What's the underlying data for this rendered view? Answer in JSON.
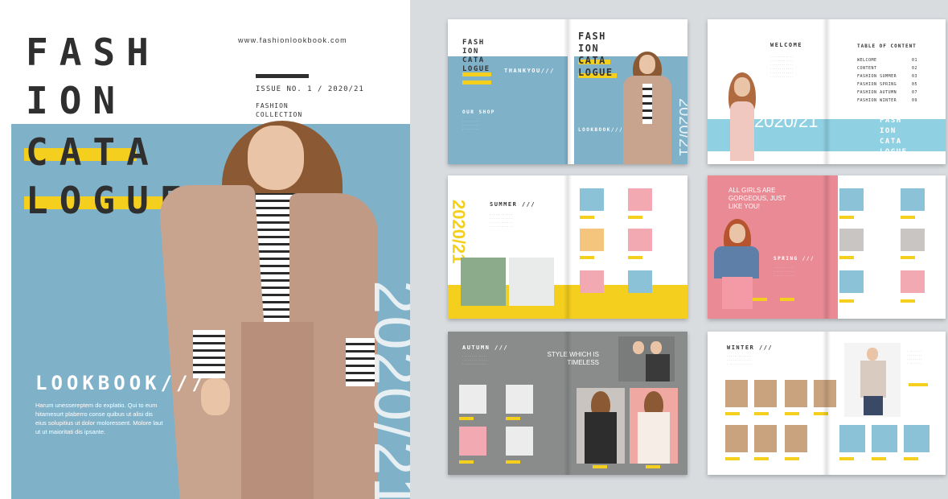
{
  "cover": {
    "title_lines": [
      "FASH",
      "ION",
      "CATA",
      "LOGUE"
    ],
    "website": "www.fashionlookbook.com",
    "issue": "ISSUE NO. 1 / 2020/21",
    "collection": "FASHION\nCOLLECTION",
    "year": "2020/21",
    "lookbook": "LOOKBOOK///",
    "body_text": "Harum unessereptem do explatio. Qui to eum hitamesurt plaberro conse quibus ut alisi dis eius solupitius ut dolor moloressent. Molore laut ut ut maioritati dis ipsante."
  },
  "colors": {
    "accent": "#f5cf1d",
    "blue": "#7fb1c9",
    "pink": "#e98a95",
    "grey": "#8a8c8c",
    "dark_text": "#2f2f2f"
  },
  "spreads": {
    "s1": {
      "title_lines": [
        "FASH",
        "ION",
        "CATA",
        "LOGUE"
      ],
      "thankyou": "THANKYOU///",
      "our_shop": "OUR SHOP",
      "right_title_lines": [
        "FASH",
        "ION",
        "CATA",
        "LOGUE"
      ],
      "lookbook": "LOOKBOOK///",
      "year": "2020/21"
    },
    "s2": {
      "welcome": "WELCOME",
      "year": "2020/21",
      "toc_title": "TABLE OF CONTENT",
      "toc": [
        {
          "label": "WELCOME",
          "page": "01"
        },
        {
          "label": "CONTENT",
          "page": "02"
        },
        {
          "label": "FASHION SUMMER",
          "page": "03"
        },
        {
          "label": "FASHION SPRING",
          "page": "05"
        },
        {
          "label": "FASHION AUTUMN",
          "page": "07"
        },
        {
          "label": "FASHION WINTER",
          "page": "09"
        }
      ],
      "side_title": "FASH ION CATA LOGUE"
    },
    "s3": {
      "summer": "SUMMER ///",
      "year": "2020/21"
    },
    "s4": {
      "headline": "ALL GIRLS ARE GORGEOUS, JUST LIKE YOU!",
      "spring": "SPRING ///"
    },
    "s5": {
      "autumn": "AUTUMN ///",
      "headline": "STYLE WHICH IS TIMELESS"
    },
    "s6": {
      "winter": "WINTER ///"
    }
  }
}
